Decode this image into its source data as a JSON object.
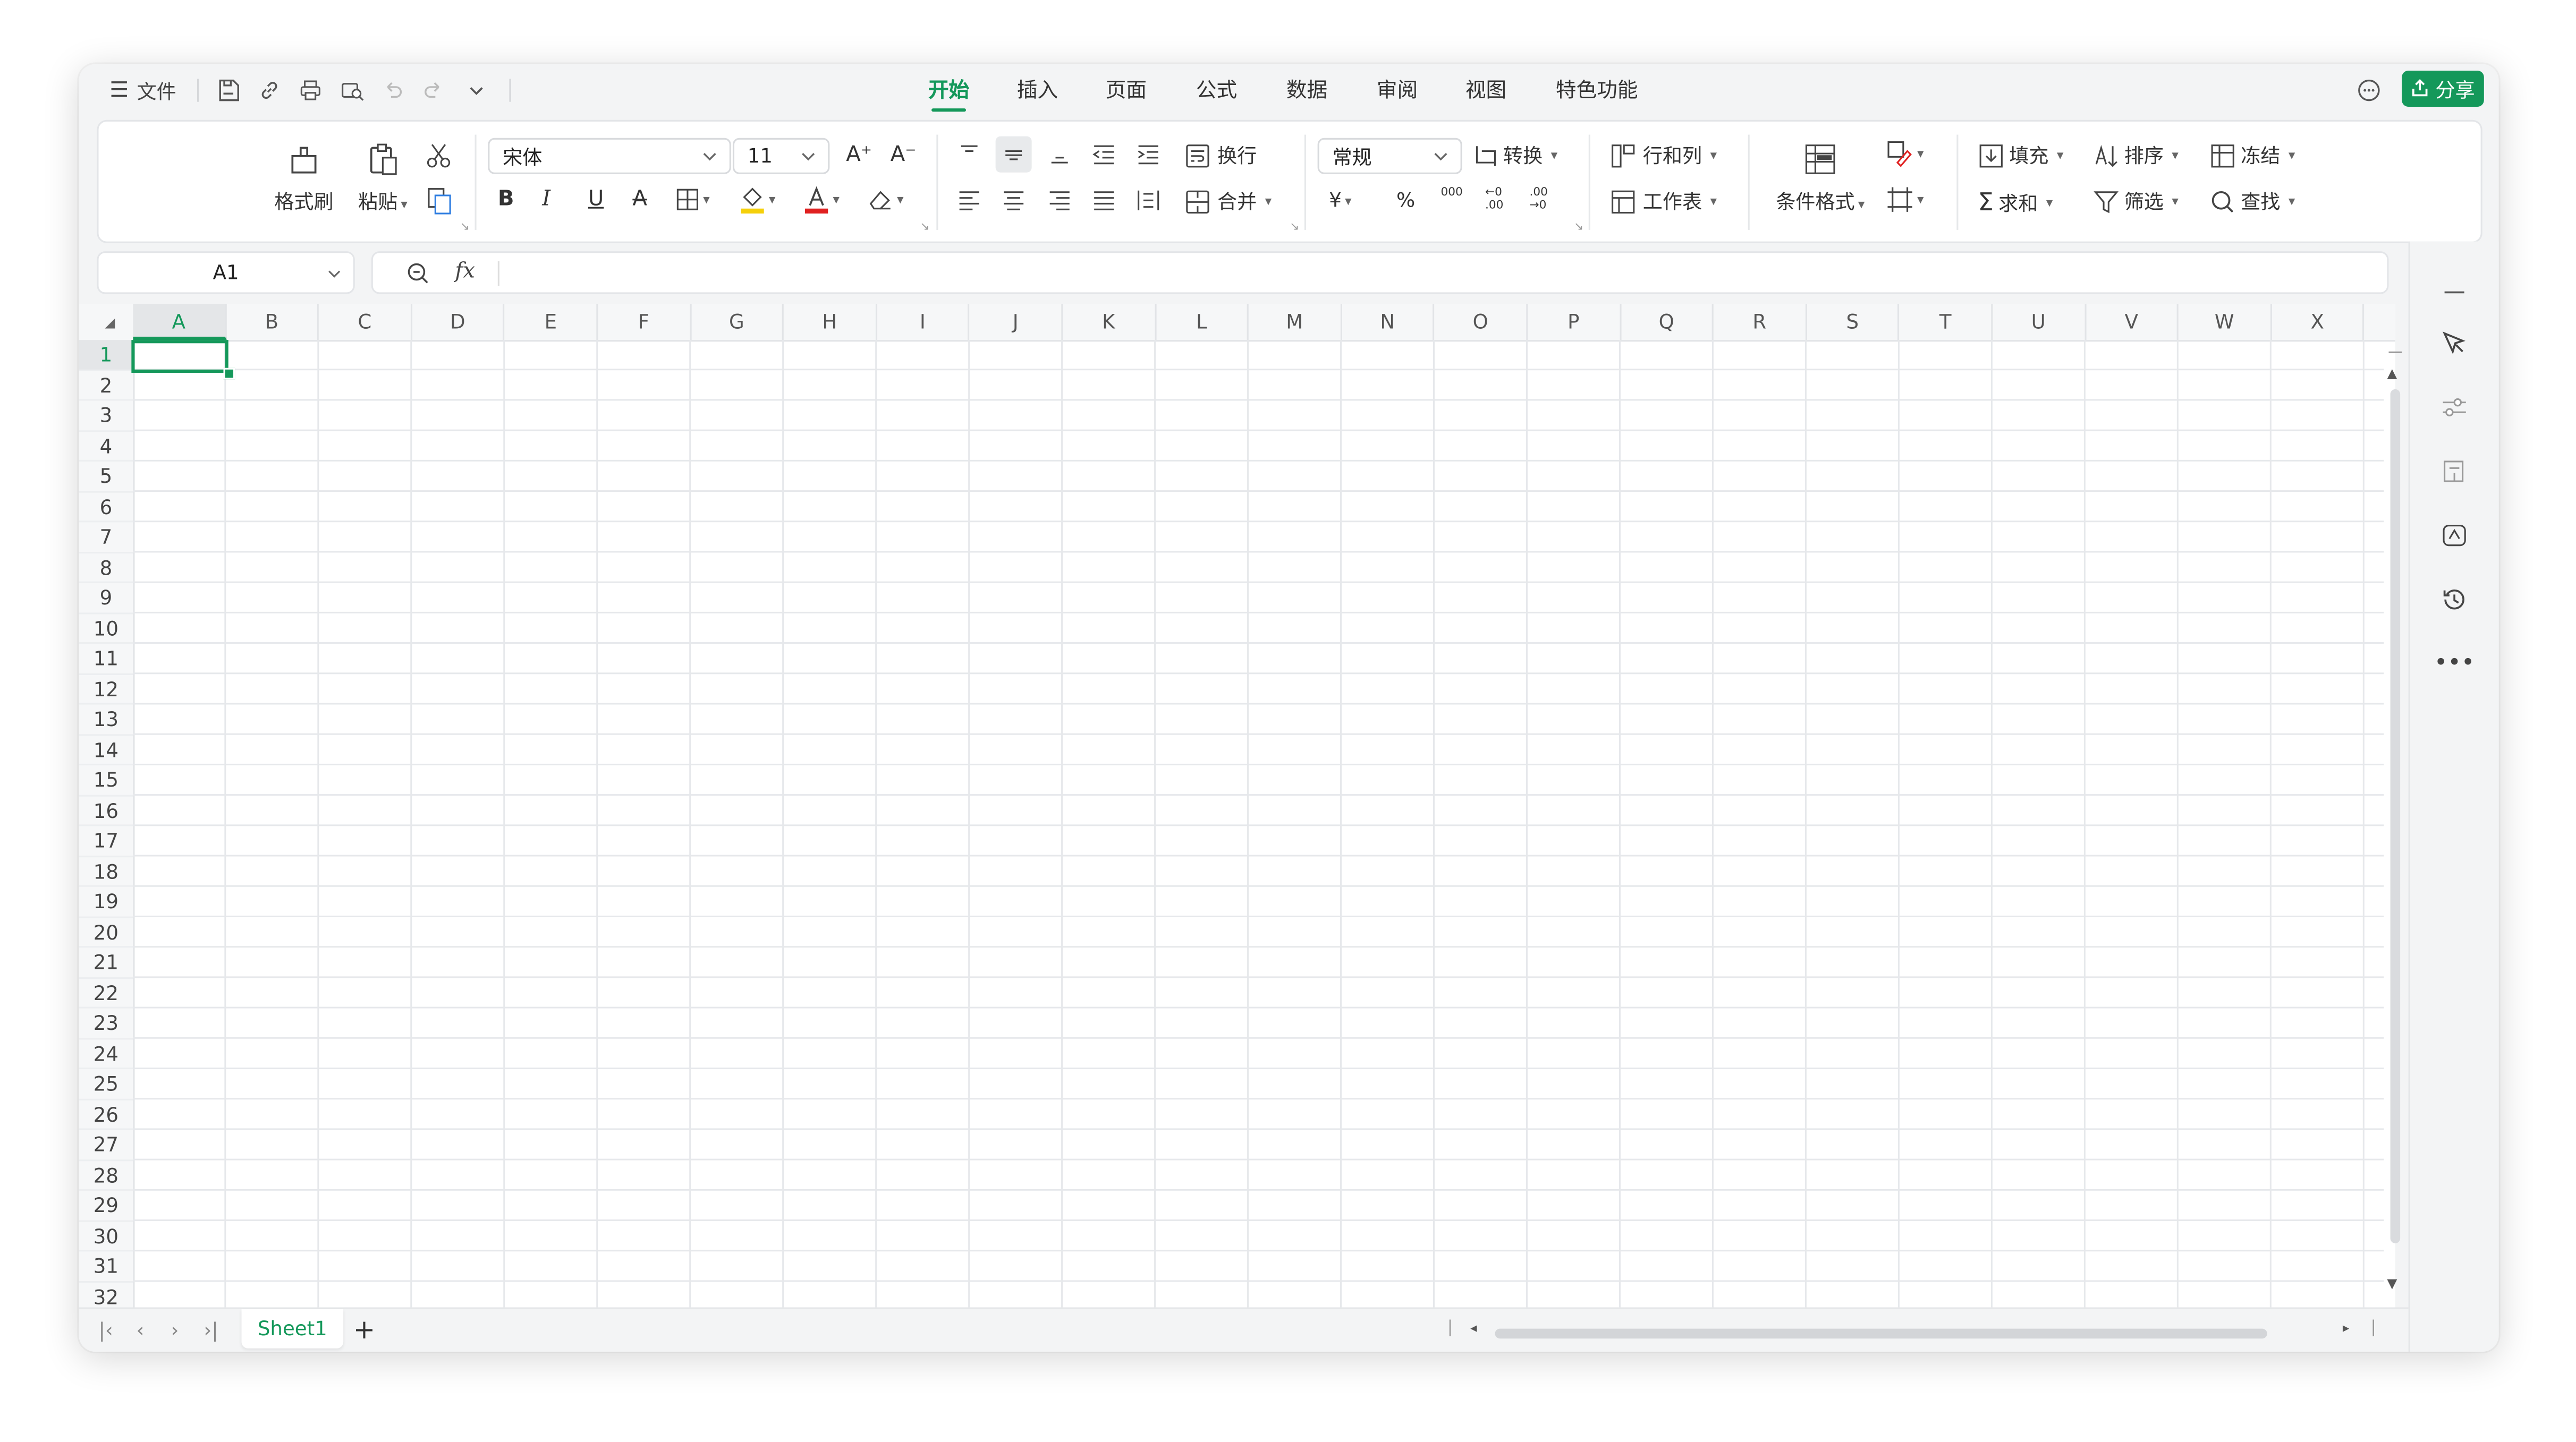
{
  "titlebar": {
    "menu_label": "文件",
    "tabs": [
      "开始",
      "插入",
      "页面",
      "公式",
      "数据",
      "审阅",
      "视图",
      "特色功能"
    ],
    "active_tab": "开始",
    "share_label": "分享"
  },
  "ribbon": {
    "clipboard": {
      "format_painter": "格式刷",
      "paste": "粘贴"
    },
    "font": {
      "family": "宋体",
      "size": "11",
      "bold": "B",
      "italic": "I",
      "underline": "U",
      "strike": "A",
      "increase": "A⁺",
      "decrease": "A⁻"
    },
    "alignment": {
      "wrap": "换行",
      "merge": "合并"
    },
    "number": {
      "format": "常规",
      "convert": "转换",
      "currency": "¥",
      "percent": "%",
      "thousands": "000",
      "inc_decimal": "←0 .00",
      "dec_decimal": ".00 →0"
    },
    "cells": {
      "row_col": "行和列",
      "worksheet": "工作表"
    },
    "styles": {
      "conditional": "条件格式"
    },
    "editing": {
      "fill": "填充",
      "sort": "排序",
      "freeze": "冻结",
      "sum": "求和",
      "filter": "筛选",
      "find": "查找"
    }
  },
  "formula_bar": {
    "name_box": "A1",
    "fx": "fx",
    "value": ""
  },
  "sheet": {
    "columns": [
      "A",
      "B",
      "C",
      "D",
      "E",
      "F",
      "G",
      "H",
      "I",
      "J",
      "K",
      "L",
      "M",
      "N",
      "O",
      "P",
      "Q",
      "R",
      "S",
      "T",
      "U",
      "V",
      "W",
      "X"
    ],
    "rows": [
      "1",
      "2",
      "3",
      "4",
      "5",
      "6",
      "7",
      "8",
      "9",
      "10",
      "11",
      "12",
      "13",
      "14",
      "15",
      "16",
      "17",
      "18",
      "19",
      "20",
      "21",
      "22",
      "23",
      "24",
      "25",
      "26",
      "27",
      "28",
      "29",
      "30",
      "31",
      "32"
    ],
    "selected_cell": "A1"
  },
  "sheet_tabs": [
    "Sheet1"
  ],
  "colors": {
    "accent": "#14985a"
  }
}
